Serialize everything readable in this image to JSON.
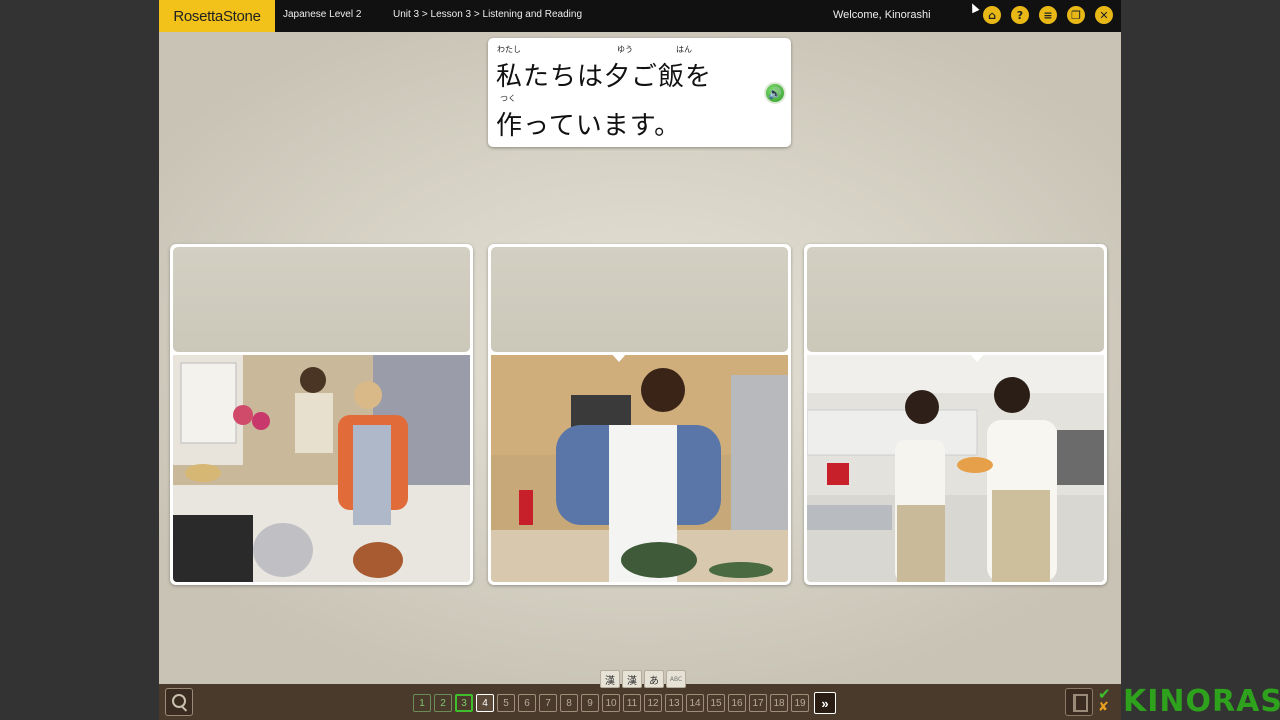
{
  "header": {
    "brand": "RosettaStone",
    "course": "Japanese Level 2",
    "breadcrumb": "Unit 3 > Lesson 3 > Listening and Reading",
    "welcome": "Welcome, Kinorashi",
    "icons": [
      "home-icon",
      "help-icon",
      "menu-icon",
      "window-icon",
      "close-icon"
    ]
  },
  "prompt": {
    "line1": "私たちは夕ご飯を",
    "line2": "作っています。",
    "ruby": [
      "わたし",
      "ゆう",
      "はん",
      "つく"
    ]
  },
  "cards": [
    {
      "scene": "couple-cooking-at-stove"
    },
    {
      "scene": "man-mixing-in-bowl"
    },
    {
      "scene": "two-women-in-kitchen"
    }
  ],
  "scripts": [
    "漢",
    "漢",
    "あ",
    "ABC"
  ],
  "pages": {
    "completed": [
      "1",
      "2",
      "3"
    ],
    "current": "4",
    "remaining": [
      "5",
      "6",
      "7",
      "8",
      "9",
      "10",
      "11",
      "12",
      "13",
      "14",
      "15",
      "16",
      "17",
      "18",
      "19"
    ],
    "next_label": "»"
  },
  "watermark": "KINORASHI",
  "colors": {
    "brand": "#f2c21a",
    "background": "#cfcbbe",
    "bottom_bar": "#4a3a2c",
    "check": "#3fbf2c"
  }
}
